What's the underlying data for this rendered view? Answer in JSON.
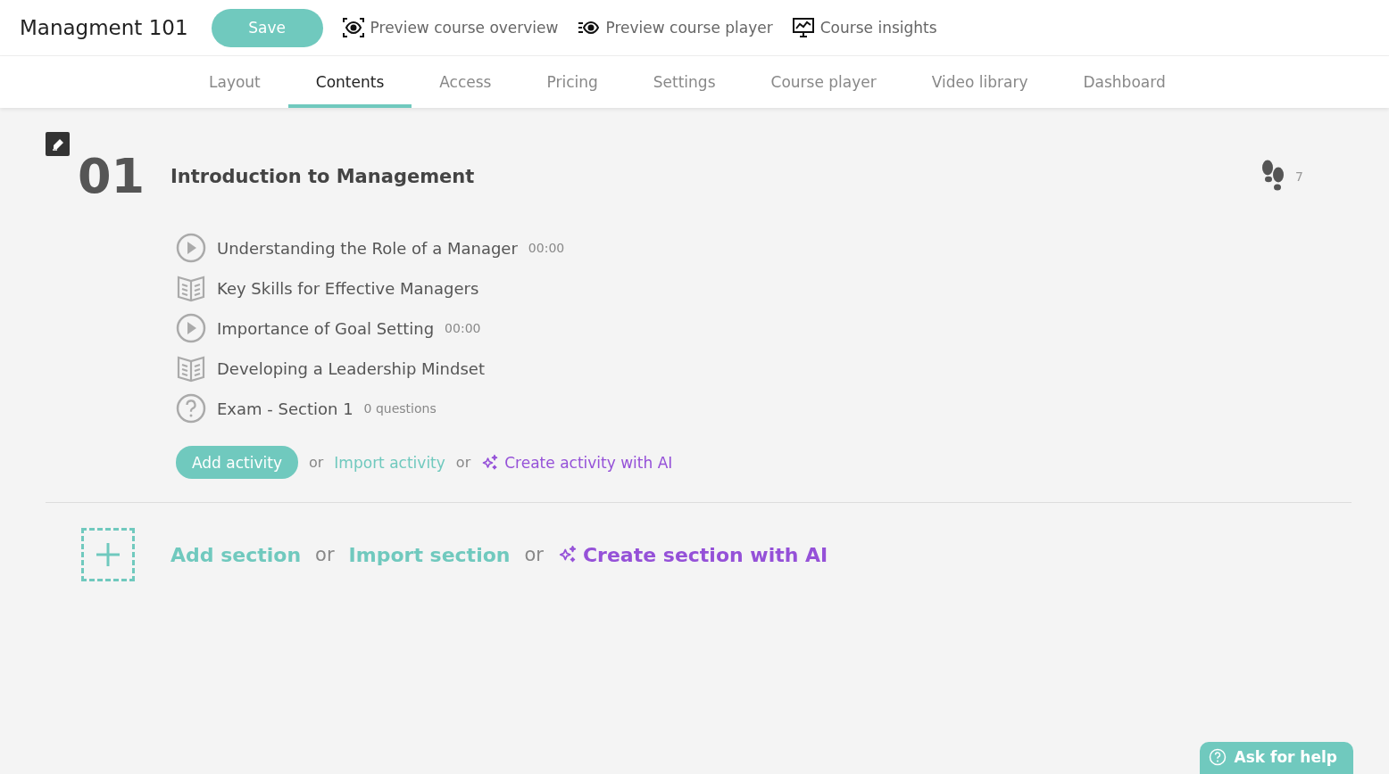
{
  "course_title": "Managment 101",
  "save_button": "Save",
  "header_links": [
    {
      "kind": "overview",
      "label": "Preview course overview"
    },
    {
      "kind": "player",
      "label": "Preview course player"
    },
    {
      "kind": "insights",
      "label": "Course insights"
    }
  ],
  "tabs": [
    {
      "label": "Layout",
      "selected": false
    },
    {
      "label": "Contents",
      "selected": true
    },
    {
      "label": "Access",
      "selected": false
    },
    {
      "label": "Pricing",
      "selected": false
    },
    {
      "label": "Settings",
      "selected": false
    },
    {
      "label": "Course player",
      "selected": false
    },
    {
      "label": "Video library",
      "selected": false
    },
    {
      "label": "Dashboard",
      "selected": false
    }
  ],
  "section": {
    "number": "01",
    "title": "Introduction to Management",
    "steps_count": "7",
    "activities": [
      {
        "kind": "video",
        "title": "Understanding the Role of a Manager",
        "meta": "00:00"
      },
      {
        "kind": "reading",
        "title": "Key Skills for Effective Managers"
      },
      {
        "kind": "video",
        "title": "Importance of Goal Setting",
        "meta": "00:00"
      },
      {
        "kind": "reading",
        "title": "Developing a Leadership Mindset"
      },
      {
        "kind": "exam",
        "title": "Exam - Section 1",
        "meta": "0 questions"
      }
    ],
    "add_activity": "Add activity",
    "or_1": "or",
    "import_activity": "Import activity",
    "or_2": "or",
    "create_activity_ai": "Create activity with AI"
  },
  "add_section": "Add section",
  "or_1": "or",
  "import_section": "Import section",
  "or_2": "or",
  "create_section_ai": "Create section with AI",
  "help_button": "Ask for help"
}
